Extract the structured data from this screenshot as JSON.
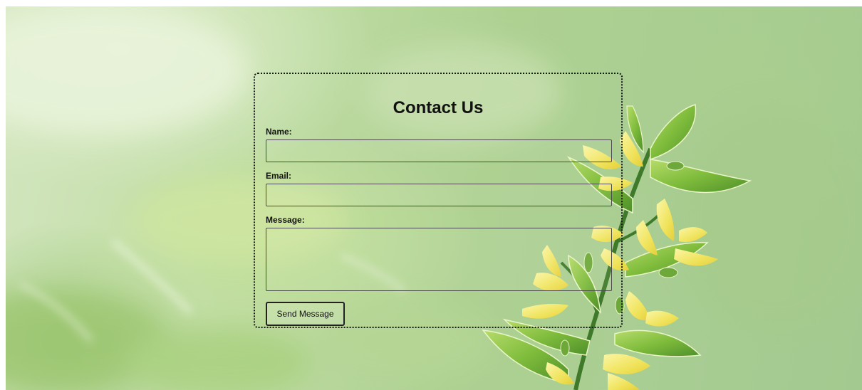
{
  "contact_form": {
    "title": "Contact Us",
    "name_label": "Name:",
    "name_value": "",
    "email_label": "Email:",
    "email_value": "",
    "message_label": "Message:",
    "message_value": "",
    "submit_label": "Send Message"
  },
  "background": {
    "illustration": "yellow-flower-branch",
    "colors": {
      "sky_light": "#d3e6bf",
      "leaf_green": "#a8cd93",
      "petal_yellow": "#f2e46a",
      "leaf_dark": "#5a9a32",
      "stem": "#3f7a2a"
    }
  },
  "card_style": {
    "border_color": "#1a1a1a",
    "border_style": "dotted"
  }
}
